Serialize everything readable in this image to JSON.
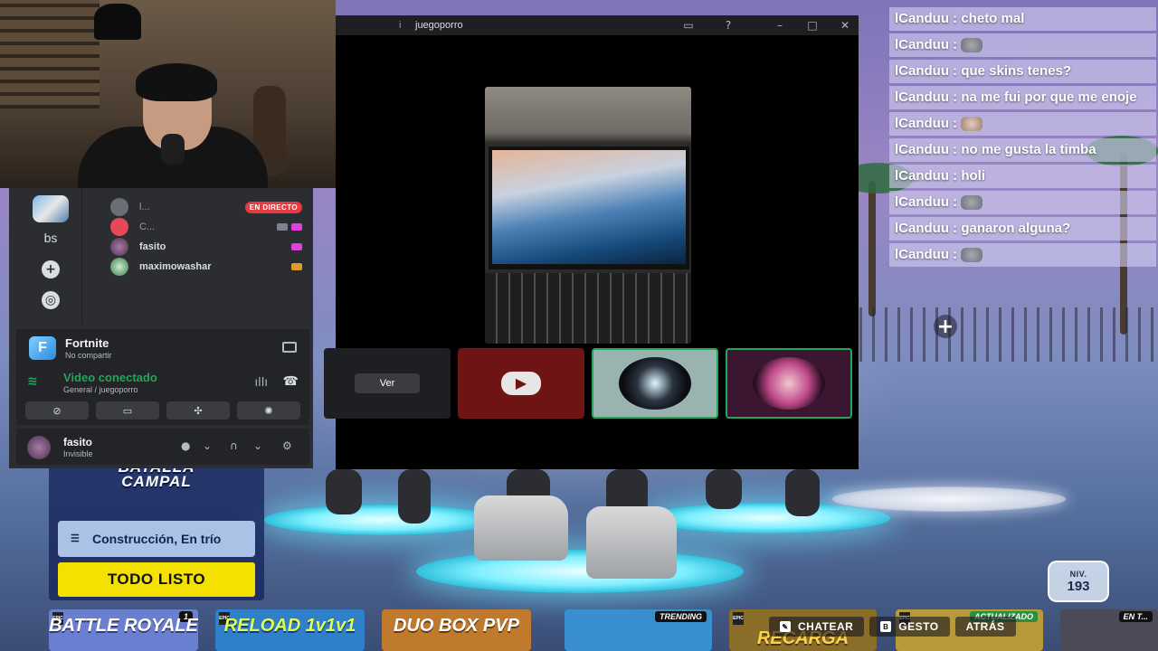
{
  "call": {
    "channel": "juegoporro",
    "hash": "i",
    "ver_label": "Ver"
  },
  "discord": {
    "server_bs": "bs",
    "voice_users": [
      {
        "name": "l...",
        "live": "EN DIRECTO"
      },
      {
        "name": "C..."
      },
      {
        "name": "fasito"
      },
      {
        "name": "maximowashar"
      }
    ],
    "activity": {
      "game": "Fortnite",
      "status": "No compartir",
      "icon_letter": "F"
    },
    "voice": {
      "status": "Video conectado",
      "location": "General / juegoporro"
    },
    "user": {
      "name": "fasito",
      "status": "Invisible"
    }
  },
  "chat": [
    {
      "user": "lCanduu",
      "text": "cheto mal"
    },
    {
      "user": "lCanduu",
      "text": "",
      "emote": "rat-emote"
    },
    {
      "user": "lCanduu",
      "text": "que skins tenes?"
    },
    {
      "user": "lCanduu",
      "text": "na me fui por que me enoje"
    },
    {
      "user": "lCanduu",
      "text": "",
      "emote": "cat-emote"
    },
    {
      "user": "lCanduu",
      "text": "no me gusta la timba"
    },
    {
      "user": "lCanduu",
      "text": "holi"
    },
    {
      "user": "lCanduu",
      "text": "",
      "emote": "rat-emote"
    },
    {
      "user": "lCanduu",
      "text": "ganaron alguna?"
    },
    {
      "user": "lCanduu",
      "text": "",
      "emote": "rat-emote"
    }
  ],
  "game": {
    "mode_line1": "BATALLA",
    "mode_line2": "CAMPAL",
    "mode_option": "Construcción, En trío",
    "ready": "TODO LISTO",
    "level_label": "NIV.",
    "level_value": "193",
    "actions": [
      {
        "key": "",
        "label": "CHATEAR"
      },
      {
        "key": "B",
        "label": "GESTO"
      },
      {
        "key": "",
        "label": "ATRÁS"
      }
    ],
    "tiles": [
      {
        "title": "BATTLE ROYALE",
        "badge": "1",
        "color": "#6a7fd0"
      },
      {
        "title": "RELOAD 1v1v1",
        "badge": "",
        "color": "#2f7fc9"
      },
      {
        "title": "DUO BOX PVP",
        "badge": "",
        "color": "#c07a2e"
      },
      {
        "title": "",
        "badge": "TRENDING",
        "color": "#3a8fd0"
      },
      {
        "title": "RECARGA",
        "badge": "",
        "color": "#8b6d2a"
      },
      {
        "title": "",
        "badge": "ACTUALIZADO",
        "color": "#b89a3a"
      },
      {
        "title": "",
        "badge": "EN T...",
        "color": "#4a4a58"
      }
    ]
  },
  "colors": {
    "discord_bg": "#2b2d31",
    "connected_green": "#23a55a",
    "live_red": "#e63a40",
    "ready_yellow": "#f4e100"
  }
}
